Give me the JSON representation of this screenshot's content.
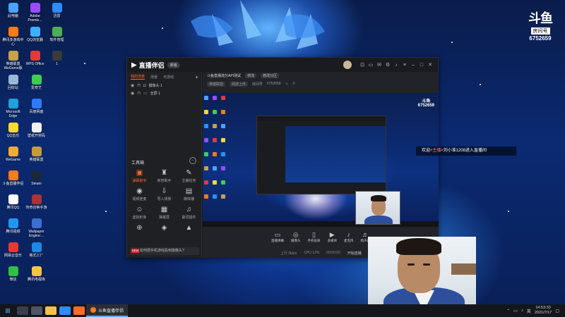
{
  "desktop_icons": [
    {
      "label": "此电脑",
      "color": "#4aa3ff"
    },
    {
      "label": "Adobe Premie...",
      "color": "#9a4bff"
    },
    {
      "label": "迅雷",
      "color": "#2f8cff"
    },
    {
      "label": "腾讯多游戏中心",
      "color": "#ff7b1a"
    },
    {
      "label": "QQ浏览器",
      "color": "#3db0ff"
    },
    {
      "label": "软件管理",
      "color": "#4caf50"
    },
    {
      "label": "英雄联盟 WeGame版",
      "color": "#c8a14a"
    },
    {
      "label": "WPS Office",
      "color": "#e53935"
    },
    {
      "label": "1",
      "color": "#3a3a3a"
    },
    {
      "label": "回收站",
      "color": "#9bb7d6"
    },
    {
      "label": "爱奇艺",
      "color": "#3ccf4e"
    },
    {
      "label": "Microsoft Edge",
      "color": "#1fa0d8"
    },
    {
      "label": "百度网盘",
      "color": "#2f7bff"
    },
    {
      "label": "QQ音乐",
      "color": "#fdd835"
    },
    {
      "label": "壁纸开奖码",
      "color": "#f0f0f0"
    },
    {
      "label": "WeGame",
      "color": "#f2a93b"
    },
    {
      "label": "英雄联盟",
      "color": "#c49a3c"
    },
    {
      "label": "斗鱼直播伴侣",
      "color": "#ff7a22"
    },
    {
      "label": "Steam",
      "color": "#1b2838"
    },
    {
      "label": "腾讯QQ",
      "color": "#ffffff"
    },
    {
      "label": "传奇召唤手游",
      "color": "#a33"
    },
    {
      "label": "腾讯视频",
      "color": "#2196f3"
    },
    {
      "label": "Wallpaper Engine:...",
      "color": "#3d6fd1"
    },
    {
      "label": "网易云音乐",
      "color": "#e53935"
    },
    {
      "label": "格式工厂",
      "color": "#1e88e5"
    },
    {
      "label": "微信",
      "color": "#2fbf46"
    },
    {
      "label": "腾讯电视库",
      "color": "#f5c542"
    }
  ],
  "brand": {
    "logo": "斗鱼",
    "room_label": "房间号",
    "room_no": "6752659"
  },
  "app": {
    "name": "直播伴侣",
    "version": "新版",
    "title_icons": [
      "cast-icon",
      "screen-icon",
      "gift-icon",
      "settings-icon",
      "bell-icon",
      "menu-icon"
    ],
    "scene_tabs": [
      "我的场景",
      "场景",
      "可游戏"
    ],
    "scenes": [
      {
        "label": "摄像头 1"
      },
      {
        "label": "全屏 1"
      }
    ],
    "tools_title": "工具箱",
    "tools": [
      {
        "label": "弹幕助手",
        "icon": "danmaku-icon",
        "glyph": "▣",
        "hot": true
      },
      {
        "label": "房管助手",
        "icon": "user-manage-icon",
        "glyph": "♜"
      },
      {
        "label": "主播任务",
        "icon": "task-icon",
        "glyph": "✎"
      },
      {
        "label": "视频连麦",
        "icon": "video-link-icon",
        "glyph": "◉"
      },
      {
        "label": "导入场景",
        "icon": "import-icon",
        "glyph": "⇩"
      },
      {
        "label": "媒体播",
        "icon": "media-icon",
        "glyph": "▤"
      },
      {
        "label": "虚拟形象",
        "icon": "avatar-icon",
        "glyph": "☺"
      },
      {
        "label": "弹幕屏",
        "icon": "danmaku-screen-icon",
        "glyph": "▦"
      },
      {
        "label": "歌词插件",
        "icon": "lyrics-icon",
        "glyph": "♫"
      },
      {
        "label": "",
        "icon": "more-icon-1",
        "glyph": "⊕"
      },
      {
        "label": "",
        "icon": "more-icon-2",
        "glyph": "◈"
      },
      {
        "label": "",
        "icon": "more-icon-3",
        "glyph": "▲"
      }
    ],
    "tip_new": "NEW",
    "tip_text": "如何把手机游戏投到摄像头?",
    "live_title": "斗鱼直播流分API测试",
    "live_title_chip_1": "修改",
    "live_title_chip_2": "修改分区",
    "info_category": "英雄联盟",
    "info_sub": "网游上传",
    "info_room_prefix": "房间号",
    "info_room": "6752659",
    "info_count": "0",
    "toolbar": [
      {
        "label": "直播弹幕",
        "icon": "danmaku-toggle-icon",
        "glyph": "▭"
      },
      {
        "label": "摄像头",
        "icon": "camera-icon",
        "glyph": "◎"
      },
      {
        "label": "手机投屏",
        "icon": "phone-cast-icon",
        "glyph": "▯"
      },
      {
        "label": "多媒体",
        "icon": "multimedia-icon",
        "glyph": "▶"
      },
      {
        "label": "麦克风",
        "icon": "mic-icon",
        "glyph": "♪"
      },
      {
        "label": "扬声器",
        "icon": "speaker-icon",
        "glyph": "♬"
      }
    ],
    "status_items": [
      "上行 0kb/s",
      "CPU 12%",
      "00:00:00",
      "开始直播"
    ]
  },
  "welcome": {
    "prefix": "欢迎",
    "highlight": "#主播#",
    "suffix": "刘小准1208进入直播间"
  },
  "taskbar": {
    "app_label": "斗鱼直播伴侣",
    "time": "14:53:33",
    "date": "2021/7/17",
    "tray_lang": "英"
  }
}
